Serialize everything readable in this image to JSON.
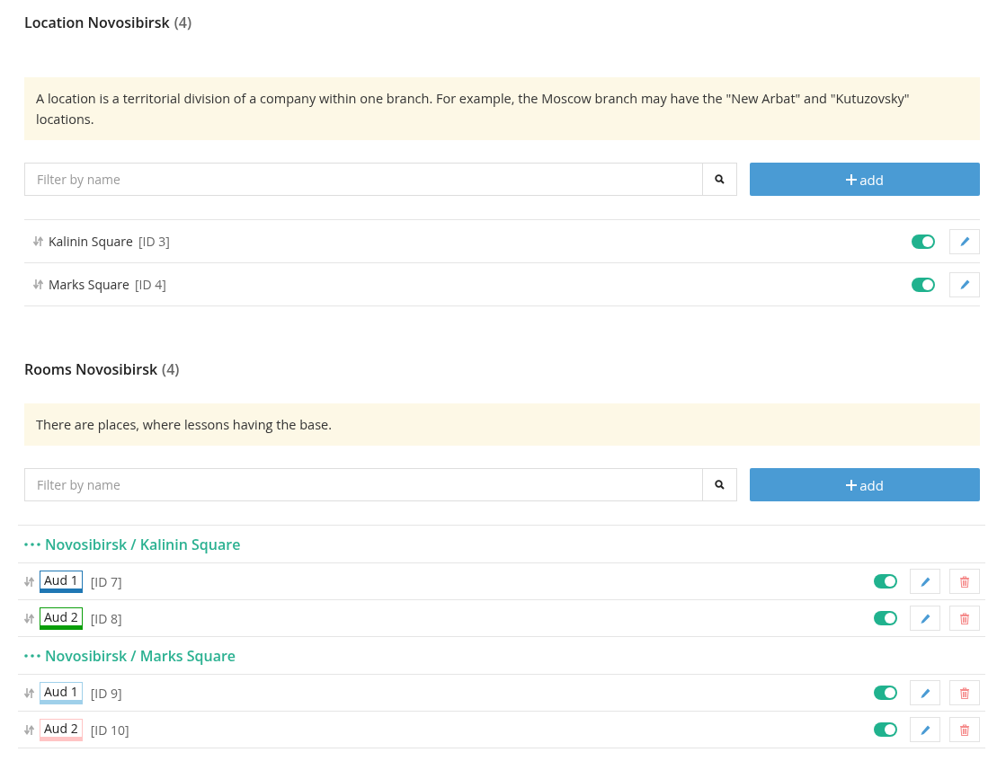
{
  "locations": {
    "title": "Location Novosibirsk",
    "count": "(4)",
    "info": "A location is a territorial division of a company within one branch. For example, the Moscow branch may have the \"New Arbat\" and \"Kutuzovsky\" locations.",
    "filter": {
      "placeholder": "Filter by name"
    },
    "add_button": "add",
    "items": [
      {
        "name": "Kalinin Square",
        "id": "[ID 3]",
        "on": true
      },
      {
        "name": "Marks Square",
        "id": "[ID 4]",
        "on": true
      }
    ]
  },
  "rooms": {
    "title": "Rooms Novosibirsk",
    "count": "(4)",
    "info": "There are places, where lessons having the base.",
    "filter": {
      "placeholder": "Filter by name"
    },
    "add_button": "add",
    "groups": [
      {
        "title": "Novosibirsk / Kalinin Square",
        "rooms": [
          {
            "name": "Aud 1",
            "id": "[ID 7]",
            "color": "#1f77b4",
            "on": true
          },
          {
            "name": "Aud 2",
            "id": "[ID 8]",
            "color": "#0a9e0a",
            "on": true
          }
        ]
      },
      {
        "title": "Novosibirsk / Marks Square",
        "rooms": [
          {
            "name": "Aud 1",
            "id": "[ID 9]",
            "color": "#9fd0ea",
            "on": true
          },
          {
            "name": "Aud 2",
            "id": "[ID 10]",
            "color": "#ffc4c4",
            "on": true
          }
        ]
      }
    ]
  }
}
